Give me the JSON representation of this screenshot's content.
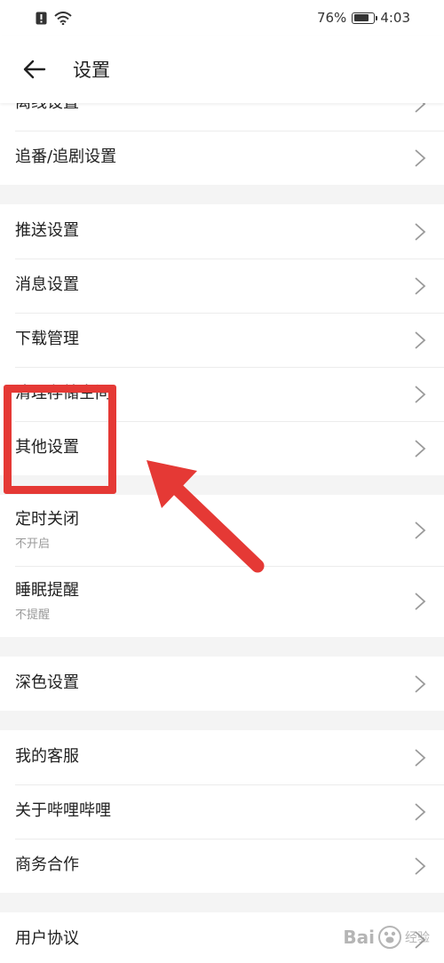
{
  "status_bar": {
    "battery": "76%",
    "battery_level": 0.76,
    "time": "4:03"
  },
  "header": {
    "title": "设置"
  },
  "groups": [
    {
      "items": [
        {
          "label": "离线设置"
        },
        {
          "label": "追番/追剧设置"
        }
      ]
    },
    {
      "items": [
        {
          "label": "推送设置"
        },
        {
          "label": "消息设置"
        },
        {
          "label": "下载管理"
        },
        {
          "label": "清理存储空间"
        },
        {
          "label": "其他设置"
        }
      ]
    },
    {
      "items": [
        {
          "label": "定时关闭",
          "sub": "不开启"
        },
        {
          "label": "睡眠提醒",
          "sub": "不提醒"
        }
      ]
    },
    {
      "items": [
        {
          "label": "深色设置"
        }
      ]
    },
    {
      "items": [
        {
          "label": "我的客服"
        },
        {
          "label": "关于哔哩哔哩"
        },
        {
          "label": "商务合作"
        }
      ]
    },
    {
      "items": [
        {
          "label": "用户协议"
        }
      ]
    }
  ],
  "annotation": {
    "color": "#e53935"
  },
  "watermark": {
    "brand": "Bai",
    "suffix": "经验"
  }
}
